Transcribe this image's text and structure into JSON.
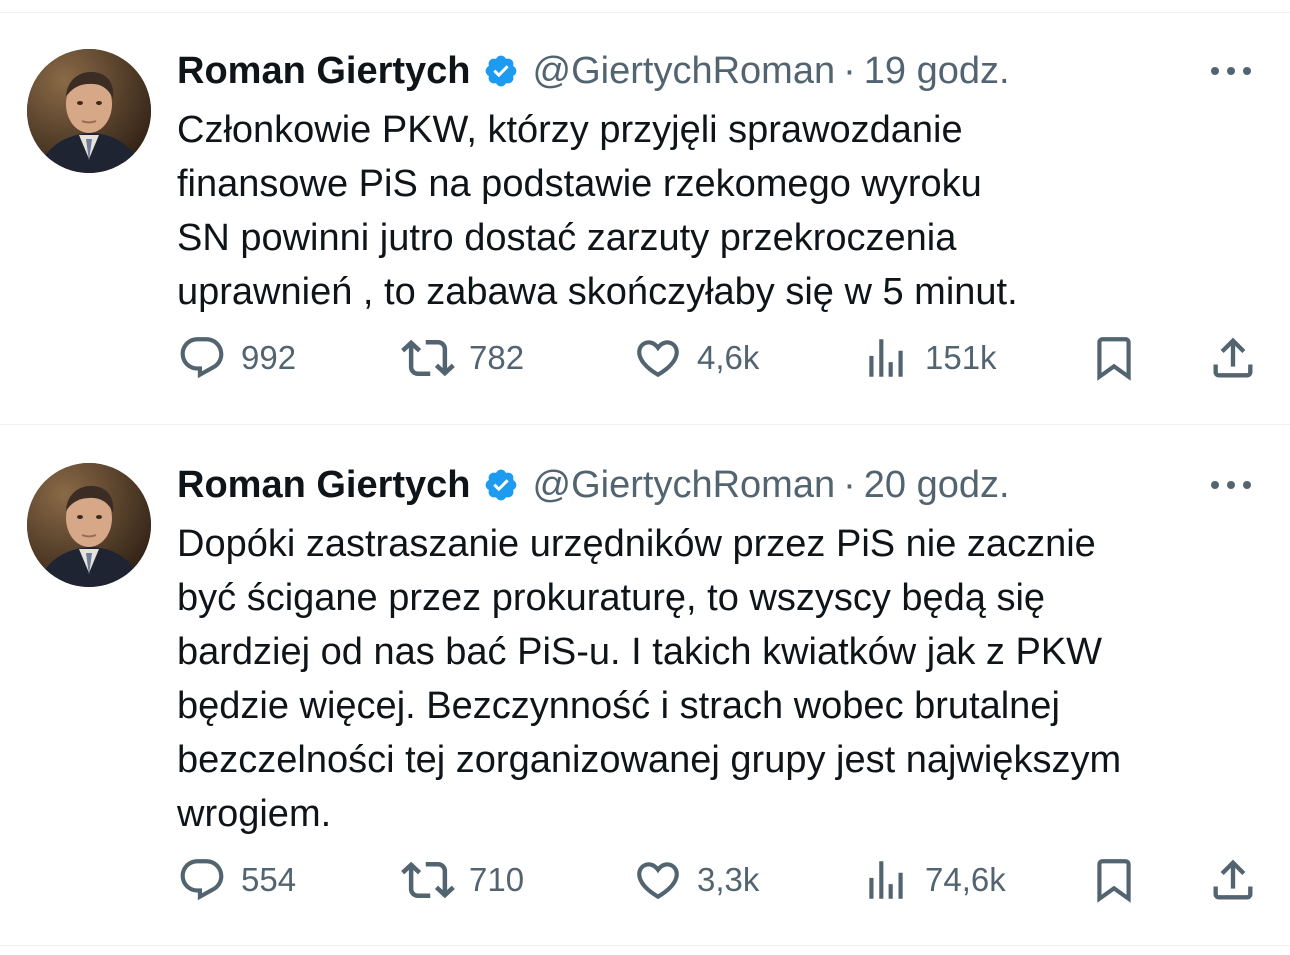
{
  "colors": {
    "text": "#0f1419",
    "secondary": "#536471",
    "verified_badge": "#1d9bf0",
    "divider": "#eff3f4"
  },
  "tweets": [
    {
      "author": {
        "name": "Roman Giertych",
        "verified": true,
        "handle": "@GiertychRoman"
      },
      "separator": "·",
      "time": "19 godz.",
      "text": "Członkowie PKW, którzy przyjęli sprawozdanie\nfinansowe PiS na podstawie rzekomego wyroku\nSN powinni jutro dostać zarzuty przekroczenia\nuprawnień , to zabawa skończyłaby się w 5 minut.",
      "stats": {
        "replies": "992",
        "retweets": "782",
        "likes": "4,6k",
        "views": "151k"
      }
    },
    {
      "author": {
        "name": "Roman Giertych",
        "verified": true,
        "handle": "@GiertychRoman"
      },
      "separator": "·",
      "time": "20 godz.",
      "text": "Dopóki zastraszanie urzędników przez PiS nie zacznie\nbyć ścigane przez prokuraturę, to wszyscy będą się\nbardziej od nas bać PiS-u. I takich kwiatków jak z PKW\nbędzie więcej. Bezczynność i strach wobec brutalnej\nbezczelności tej zorganizowanej grupy jest największym\nwrogiem.",
      "stats": {
        "replies": "554",
        "retweets": "710",
        "likes": "3,3k",
        "views": "74,6k"
      }
    }
  ],
  "icons": {
    "verified": "verified-badge-icon",
    "more": "more-dots-icon",
    "reply": "reply-bubble-icon",
    "retweet": "retweet-icon",
    "like": "heart-icon",
    "views": "views-bar-chart-icon",
    "bookmark": "bookmark-icon",
    "share": "share-upload-icon"
  }
}
